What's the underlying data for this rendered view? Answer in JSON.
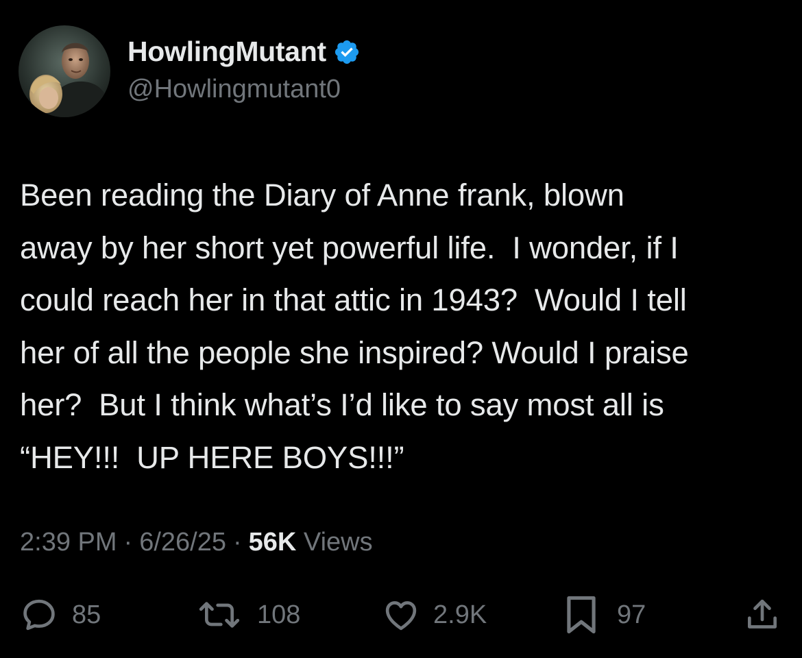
{
  "author": {
    "display_name": "HowlingMutant",
    "handle": "@Howlingmutant0",
    "verified": true,
    "verified_color": "#1d9bf0"
  },
  "tweet": {
    "text": "Been reading the Diary of Anne frank, blown\naway by her short yet powerful life.  I wonder, if I\ncould reach her in that attic in 1943?  Would I tell\nher of all the people she inspired? Would I praise\nher?  But I think what’s I’d like to say most all is\n“HEY!!!  UP HERE BOYS!!!”",
    "time": "2:39 PM",
    "date": "6/26/25",
    "separator": "·",
    "views_count": "56K",
    "views_label": "Views"
  },
  "actions": {
    "replies": "85",
    "reposts": "108",
    "likes": "2.9K",
    "bookmarks": "97"
  },
  "icons": {
    "reply": "speech-bubble-icon",
    "repost": "repost-arrows-icon",
    "like": "heart-icon",
    "bookmark": "bookmark-icon",
    "share": "share-upload-icon",
    "verified": "verified-badge-icon"
  },
  "colors": {
    "background": "#000000",
    "primary_text": "#e7e9ea",
    "secondary_text": "#71767b"
  }
}
